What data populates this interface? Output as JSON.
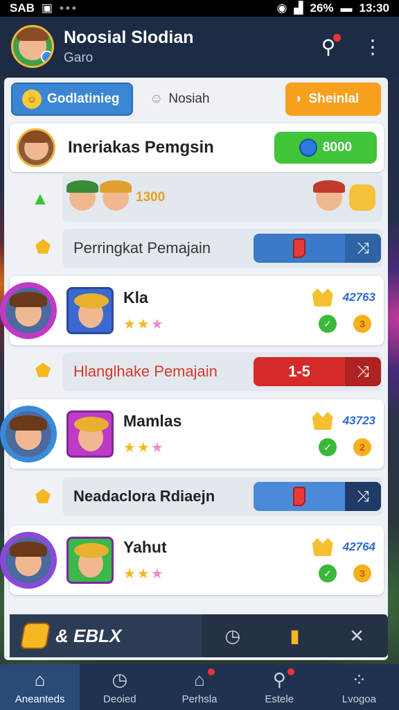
{
  "status_bar": {
    "carrier": "SAB",
    "battery": "26%",
    "time": "13:30"
  },
  "app": {
    "title": "Noosial Slodian",
    "subtitle": "Garo"
  },
  "tabs": [
    {
      "label": "Godlatinieg"
    },
    {
      "label": "Nosiah"
    },
    {
      "label": "Sheinlal"
    }
  ],
  "header": {
    "title": "Ineriakas Pemgsin",
    "coins": "8000"
  },
  "characters_row": {
    "amount": "1300"
  },
  "sections": [
    {
      "title": "Perringkat Pemajain",
      "value": ""
    },
    {
      "title": "Hlanglhake Pemajain",
      "value": "1-5"
    },
    {
      "title": "Neadaclora Rdiaejn",
      "value": ""
    }
  ],
  "players": [
    {
      "name": "Kla",
      "score": "42763",
      "stat": "3"
    },
    {
      "name": "Mamlas",
      "score": "43723",
      "stat": "2"
    },
    {
      "name": "Yahut",
      "score": "42764",
      "stat": "3"
    }
  ],
  "banner": {
    "text": "& EBLX"
  },
  "nav": [
    {
      "label": "Aneanteds"
    },
    {
      "label": "Deoied"
    },
    {
      "label": "Perhsla"
    },
    {
      "label": "Estele"
    },
    {
      "label": "Lvogoa"
    }
  ],
  "colors": {
    "accent_blue": "#3a86d4",
    "accent_orange": "#f7a01e",
    "accent_green": "#3fc43a",
    "danger": "#d62a2a"
  }
}
